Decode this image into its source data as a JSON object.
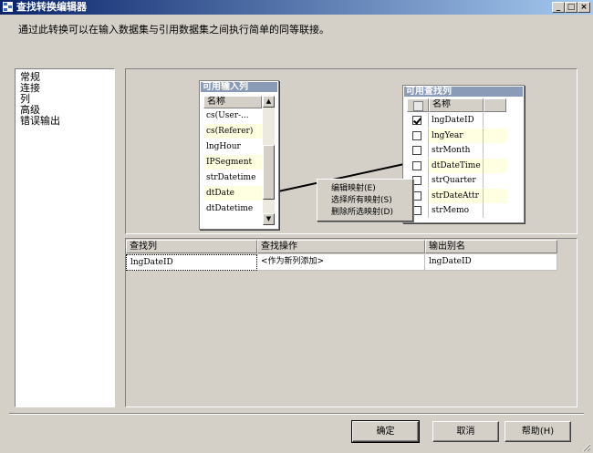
{
  "window": {
    "title": "查找转换编辑器"
  },
  "description": "通过此转换可以在输入数据集与引用数据集之间执行简单的同等联接。",
  "nav": {
    "items": [
      "常规",
      "连接",
      "列",
      "高级",
      "错误输出"
    ]
  },
  "input_table": {
    "title": "可用输入列",
    "header": "名称",
    "rows": [
      "cs(User-...",
      "cs(Referer)",
      "lngHour",
      "IPSegment",
      "strDatetime",
      "dtDate",
      "dtDatetime"
    ]
  },
  "lookup_table": {
    "title": "可用查找列",
    "header": "名称",
    "rows": [
      {
        "name": "lngDateID",
        "checked": true
      },
      {
        "name": "lngYear",
        "checked": false
      },
      {
        "name": "strMonth",
        "checked": false
      },
      {
        "name": "dtDateTime",
        "checked": false
      },
      {
        "name": "strQuarter",
        "checked": false
      },
      {
        "name": "strDateAttr",
        "checked": false
      },
      {
        "name": "strMemo",
        "checked": false
      }
    ]
  },
  "context_menu": {
    "items": [
      "编辑映射(E)",
      "选择所有映射(S)",
      "删除所选映射(D)"
    ]
  },
  "grid": {
    "headers": [
      "查找列",
      "查找操作",
      "输出别名"
    ],
    "rows": [
      [
        "lngDateID",
        "<作为新列添加>",
        "lngDateID"
      ]
    ]
  },
  "buttons": {
    "ok": "确定",
    "cancel": "取消",
    "help": "帮助(H)"
  },
  "colors": {
    "titlebar_start": "#0a246a",
    "titlebar_end": "#a6caf0",
    "table_title": "#8a9bb7",
    "row_highlight": "#ffffe1"
  }
}
